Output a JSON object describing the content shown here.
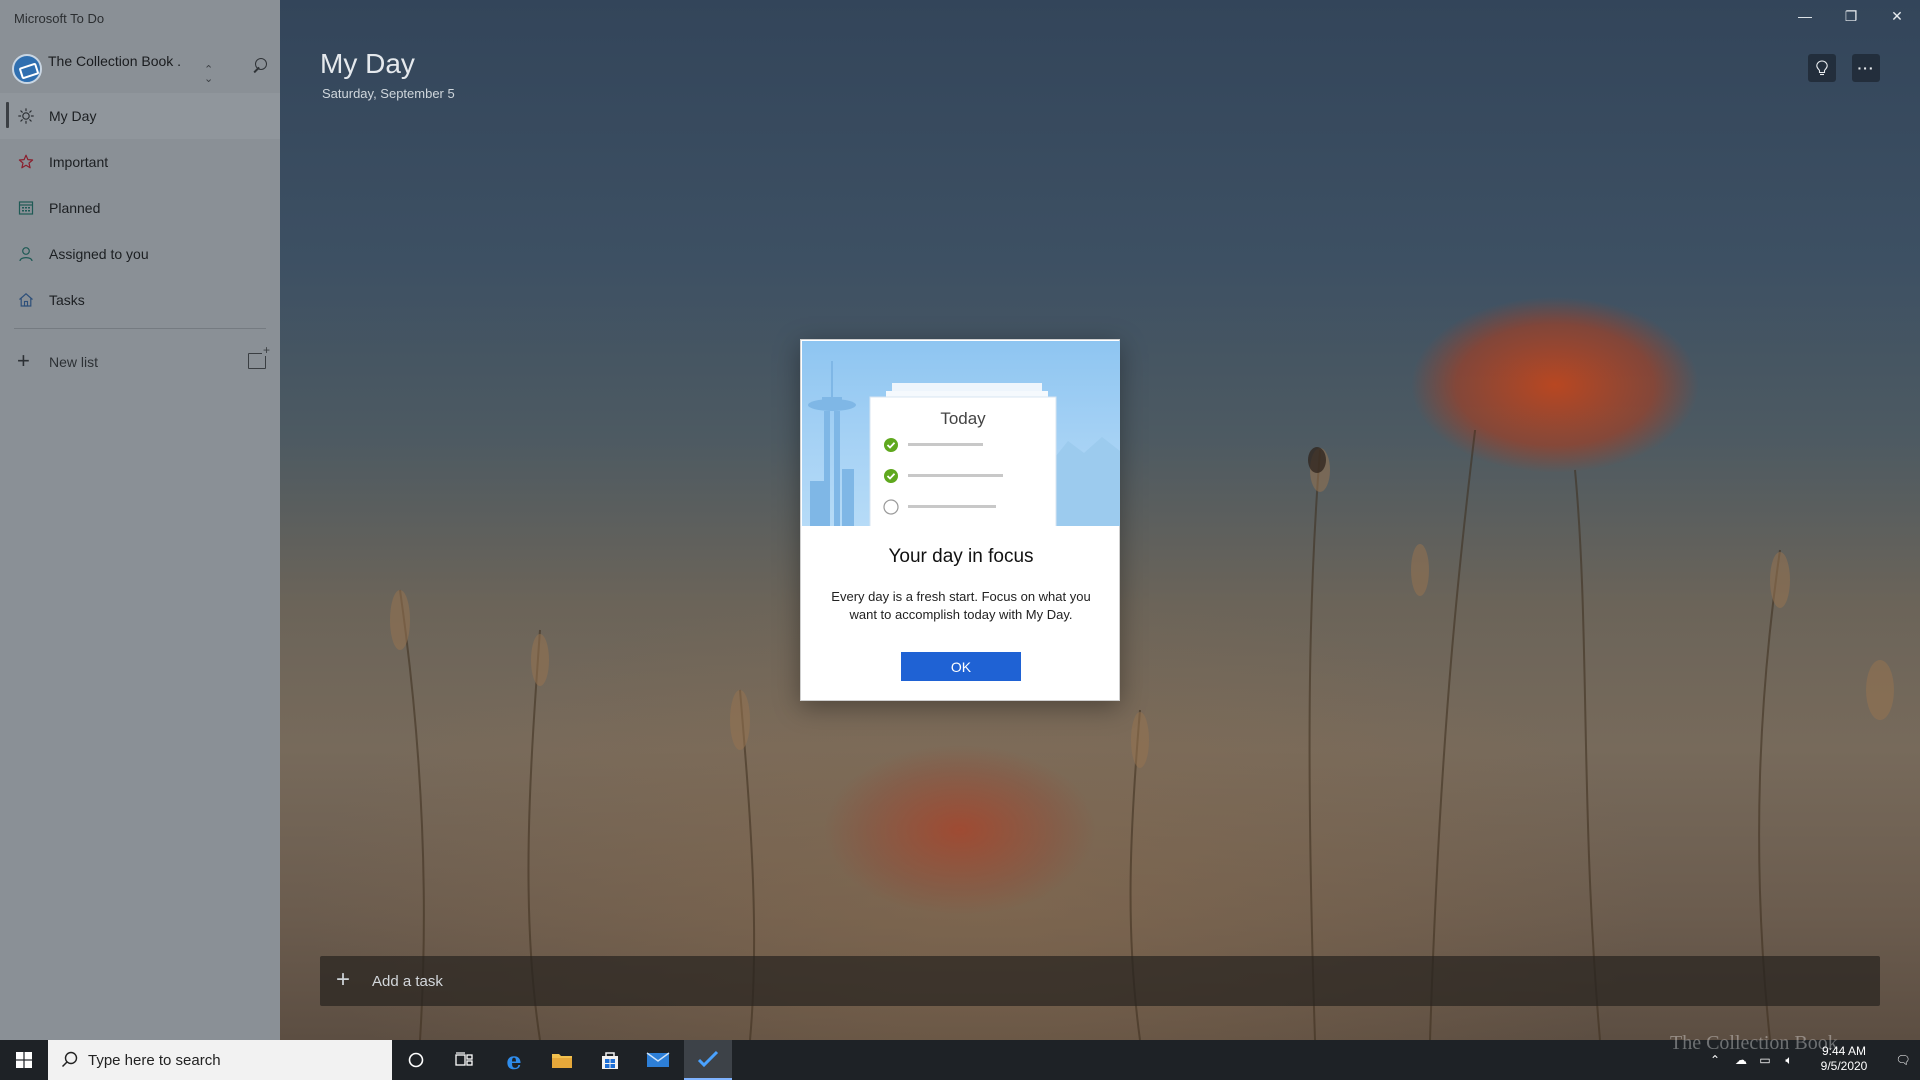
{
  "app": {
    "title": "Microsoft To Do"
  },
  "account": {
    "name": "The Collection Book ."
  },
  "sidebar": {
    "items": [
      {
        "label": "My Day",
        "icon": "sun-icon",
        "active": true
      },
      {
        "label": "Important",
        "icon": "star-icon",
        "active": false
      },
      {
        "label": "Planned",
        "icon": "calendar-icon",
        "active": false
      },
      {
        "label": "Assigned to you",
        "icon": "person-icon",
        "active": false
      },
      {
        "label": "Tasks",
        "icon": "home-icon",
        "active": false
      }
    ],
    "new_list_label": "New list"
  },
  "main": {
    "title": "My Day",
    "date": "Saturday, September 5",
    "add_task_placeholder": "Add a task"
  },
  "dialog": {
    "illustration_label": "Today",
    "illustration_items": [
      {
        "checked": true
      },
      {
        "checked": true
      },
      {
        "checked": false
      }
    ],
    "title": "Your day in focus",
    "body": "Every day is a fresh start. Focus on what you want to accomplish today with My Day.",
    "ok_label": "OK"
  },
  "taskbar": {
    "search_placeholder": "Type here to search",
    "time": "9:44 AM",
    "date": "9/5/2020",
    "watermark": "The Collection Book"
  },
  "colors": {
    "sidebar_bg": "#8a9096",
    "accent": "#1f62d4",
    "taskbar_bg": "#1e2226",
    "check_green": "#5fa81e"
  }
}
